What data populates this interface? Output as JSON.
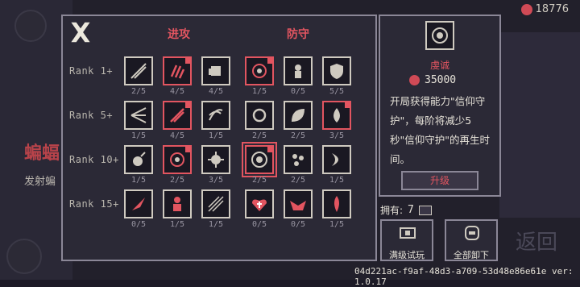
{
  "currency": {
    "value": "18776"
  },
  "panel": {
    "col_attack": "进攻",
    "col_defense": "防守",
    "ranks": [
      "Rank 1+",
      "Rank 5+",
      "Rank 10+",
      "Rank 15+"
    ],
    "attack": [
      [
        {
          "count": "2/5",
          "icon": "slash-icon",
          "active": false
        },
        {
          "count": "4/5",
          "icon": "claw-icon",
          "active": true
        },
        {
          "count": "4/5",
          "icon": "fist-icon",
          "active": false
        }
      ],
      [
        {
          "count": "1/5",
          "icon": "spread-arrow-icon",
          "active": false
        },
        {
          "count": "4/5",
          "icon": "dash-slash-icon",
          "active": true
        },
        {
          "count": "1/5",
          "icon": "vortex-icon",
          "active": false
        }
      ],
      [
        {
          "count": "1/5",
          "icon": "bomb-icon",
          "active": false
        },
        {
          "count": "2/5",
          "icon": "skull-ring-icon",
          "active": true
        },
        {
          "count": "3/5",
          "icon": "spiked-orb-icon",
          "active": false
        }
      ],
      [
        {
          "count": "0/5",
          "icon": "fire-burst-icon",
          "active": false
        },
        {
          "count": "1/5",
          "icon": "figure-icon",
          "active": false
        },
        {
          "count": "1/5",
          "icon": "arrows-icon",
          "active": false
        }
      ]
    ],
    "defense": [
      [
        {
          "count": "1/5",
          "icon": "target-ring-icon",
          "active": true
        },
        {
          "count": "0/5",
          "icon": "gem-figure-icon",
          "active": false
        },
        {
          "count": "5/5",
          "icon": "shield-icon",
          "active": false
        }
      ],
      [
        {
          "count": "2/5",
          "icon": "cycle-icon",
          "active": false
        },
        {
          "count": "2/5",
          "icon": "leaf-icon",
          "active": false
        },
        {
          "count": "3/5",
          "icon": "drop-icon",
          "active": true
        }
      ],
      [
        {
          "count": "2/5",
          "icon": "eye-orb-icon",
          "active": true,
          "selected": true
        },
        {
          "count": "2/5",
          "icon": "hearts-icon",
          "active": false
        },
        {
          "count": "1/5",
          "icon": "crescent-icon",
          "active": false
        }
      ],
      [
        {
          "count": "0/5",
          "icon": "heart-cross-icon",
          "active": false
        },
        {
          "count": "0/5",
          "icon": "winged-icon",
          "active": false
        },
        {
          "count": "1/5",
          "icon": "flame-bloom-icon",
          "active": false
        }
      ]
    ]
  },
  "info": {
    "title": "虔诚",
    "cost": "35000",
    "description": "开局获得能力\"信仰守护\"，每阶将减少5秒\"信仰守护\"的再生时间。",
    "upgrade_label": "升级"
  },
  "owned": {
    "label": "拥有:",
    "value": "7"
  },
  "buttons": {
    "trial": "满级试玩",
    "unequip": "全部卸下"
  },
  "background": {
    "red_text": "蝙蝠",
    "desc_text": "发射蝙",
    "ghost_return": "返回"
  },
  "version": "04d221ac-f9af-48d3-a709-53d48e86e61e ver: 1.0.17",
  "colors": {
    "accent": "#e25560",
    "border": "#cfcac0",
    "panel": "#2b2936"
  }
}
